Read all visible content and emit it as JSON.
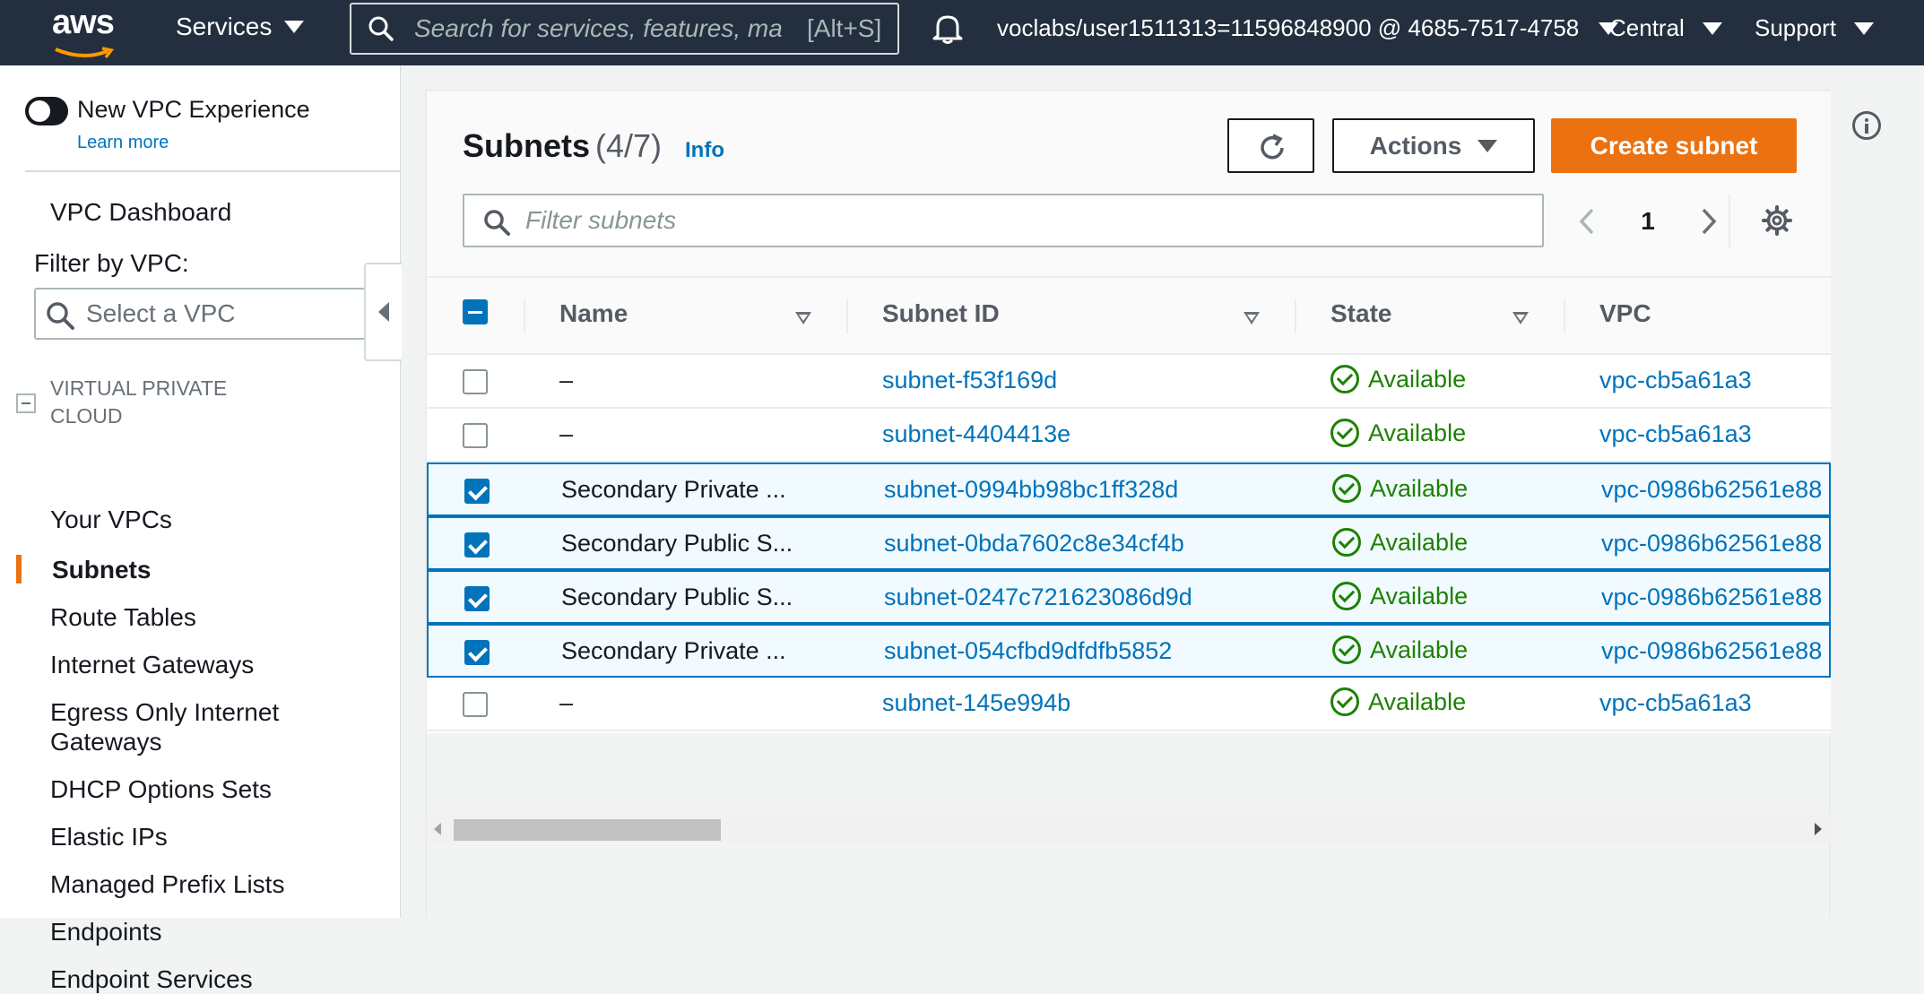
{
  "topnav": {
    "logo_text": "aws",
    "services_label": "Services",
    "search_placeholder": "Search for services, features, ma",
    "search_shortcut": "[Alt+S]",
    "account": "voclabs/user1511313=11596848900 @ 4685-7517-4758",
    "region": "Central",
    "support": "Support"
  },
  "sidebar": {
    "toggle_label": "New VPC Experience",
    "learn_more": "Learn more",
    "dashboard": "VPC Dashboard",
    "filter_label": "Filter by VPC:",
    "vpc_placeholder": "Select a VPC",
    "section_title": "Virtual Private Cloud",
    "items": [
      {
        "label": "Your VPCs"
      },
      {
        "label": "Subnets",
        "active": true
      },
      {
        "label": "Route Tables"
      },
      {
        "label": "Internet Gateways"
      },
      {
        "label": "Egress Only Internet Gateways"
      },
      {
        "label": "DHCP Options Sets"
      },
      {
        "label": "Elastic IPs"
      },
      {
        "label": "Managed Prefix Lists"
      },
      {
        "label": "Endpoints"
      },
      {
        "label": "Endpoint Services"
      }
    ]
  },
  "main": {
    "title": "Subnets",
    "count": "(4/7)",
    "info_link": "Info",
    "actions_label": "Actions",
    "create_label": "Create subnet",
    "filter_placeholder": "Filter subnets",
    "page": "1",
    "columns": [
      "Name",
      "Subnet ID",
      "State",
      "VPC"
    ],
    "rows": [
      {
        "selected": false,
        "name": "–",
        "subnet_id": "subnet-f53f169d",
        "state": "Available",
        "vpc": "vpc-cb5a61a3"
      },
      {
        "selected": false,
        "name": "–",
        "subnet_id": "subnet-4404413e",
        "state": "Available",
        "vpc": "vpc-cb5a61a3"
      },
      {
        "selected": true,
        "name": "Secondary Private ...",
        "subnet_id": "subnet-0994bb98bc1ff328d",
        "state": "Available",
        "vpc": "vpc-0986b62561e88"
      },
      {
        "selected": true,
        "name": "Secondary Public S...",
        "subnet_id": "subnet-0bda7602c8e34cf4b",
        "state": "Available",
        "vpc": "vpc-0986b62561e88"
      },
      {
        "selected": true,
        "name": "Secondary Public S...",
        "subnet_id": "subnet-0247c721623086d9d",
        "state": "Available",
        "vpc": "vpc-0986b62561e88"
      },
      {
        "selected": true,
        "name": "Secondary Private ...",
        "subnet_id": "subnet-054cfbd9dfdfb5852",
        "state": "Available",
        "vpc": "vpc-0986b62561e88"
      },
      {
        "selected": false,
        "name": "–",
        "subnet_id": "subnet-145e994b",
        "state": "Available",
        "vpc": "vpc-cb5a61a3"
      }
    ]
  },
  "colors": {
    "nav_bg": "#232f3e",
    "accent_orange": "#ec7211",
    "link_blue": "#0073bb",
    "success_green": "#1d8102"
  }
}
